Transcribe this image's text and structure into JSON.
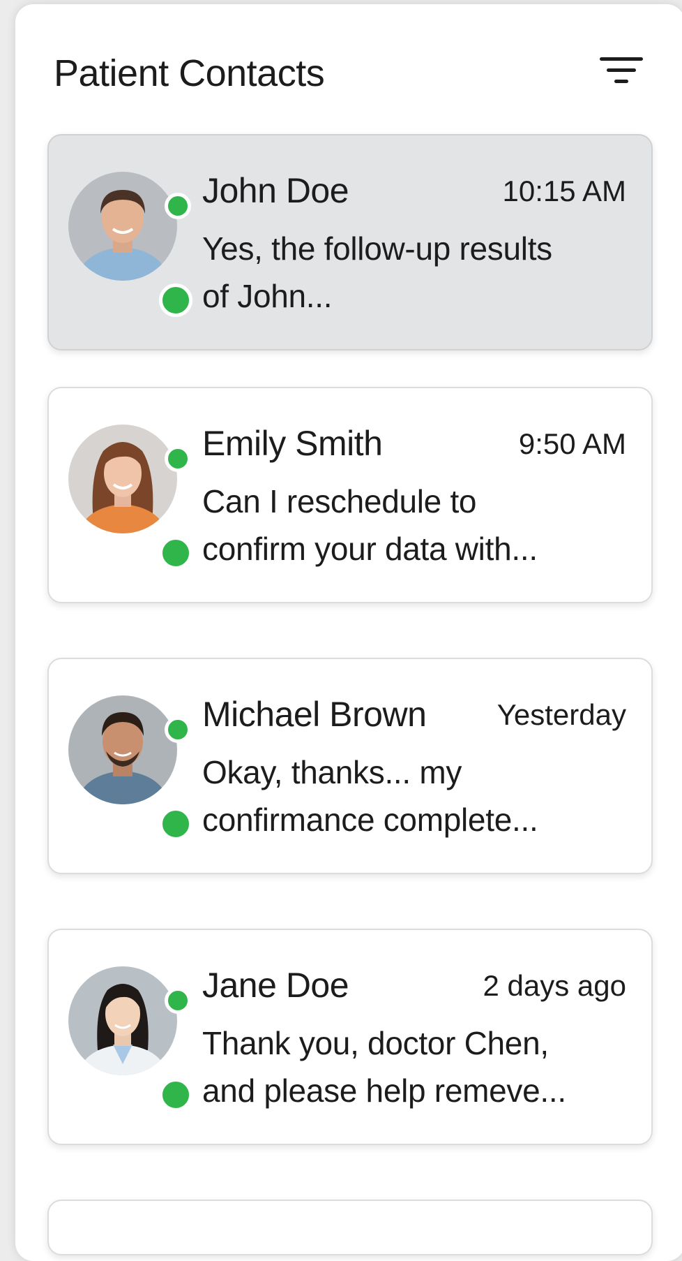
{
  "header": {
    "title": "Patient Contacts"
  },
  "contacts": [
    {
      "name": "John Doe",
      "time": "10:15 AM",
      "preview_line1": "Yes, the follow-up results",
      "preview_line2": "of John...",
      "selected": true
    },
    {
      "name": "Emily Smith",
      "time": "9:50 AM",
      "preview_line1": "Can I reschedule to",
      "preview_line2": "confirm your data with...",
      "selected": false
    },
    {
      "name": "Michael Brown",
      "time": "Yesterday",
      "preview_line1": "Okay, thanks... my",
      "preview_line2": "confirmance complete...",
      "selected": false
    },
    {
      "name": "Jane Doe",
      "time": "2 days ago",
      "preview_line1": "Thank you, doctor Chen,",
      "preview_line2": "and please help remeve...",
      "selected": false
    }
  ],
  "icons": {
    "filter": "filter-icon",
    "online": "online-status-icon"
  },
  "colors": {
    "online": "#2fb54a",
    "selected_card": "#e3e4e6",
    "text": "#1c1c1c"
  }
}
